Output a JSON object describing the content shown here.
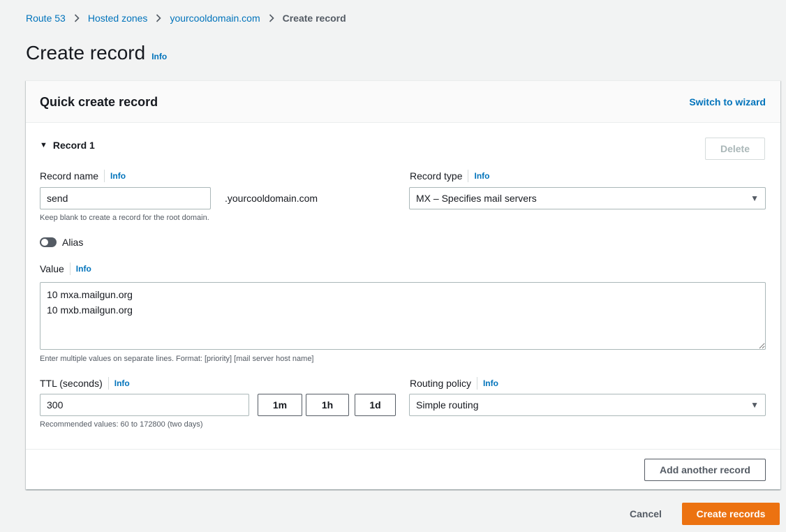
{
  "breadcrumb": {
    "items": [
      "Route 53",
      "Hosted zones",
      "yourcooldomain.com"
    ],
    "current": "Create record"
  },
  "page": {
    "title": "Create record",
    "info": "Info"
  },
  "panel": {
    "title": "Quick create record",
    "switch_wizard": "Switch to wizard",
    "record_label": "Record 1",
    "delete_label": "Delete",
    "record_name": {
      "label": "Record name",
      "info": "Info",
      "value": "send",
      "suffix": ".yourcooldomain.com",
      "hint": "Keep blank to create a record for the root domain."
    },
    "record_type": {
      "label": "Record type",
      "info": "Info",
      "value": "MX – Specifies mail servers"
    },
    "alias": {
      "label": "Alias",
      "enabled": false
    },
    "value": {
      "label": "Value",
      "info": "Info",
      "content": "10 mxa.mailgun.org\n10 mxb.mailgun.org",
      "hint": "Enter multiple values on separate lines. Format: [priority] [mail server host name]"
    },
    "ttl": {
      "label": "TTL (seconds)",
      "info": "Info",
      "value": "300",
      "presets": [
        "1m",
        "1h",
        "1d"
      ],
      "hint": "Recommended values: 60 to 172800 (two days)"
    },
    "routing_policy": {
      "label": "Routing policy",
      "info": "Info",
      "value": "Simple routing"
    },
    "add_another": "Add another record"
  },
  "footer": {
    "cancel": "Cancel",
    "create": "Create records"
  },
  "colors": {
    "link": "#0073bb",
    "primary": "#ec7211",
    "background": "#f2f3f3"
  }
}
